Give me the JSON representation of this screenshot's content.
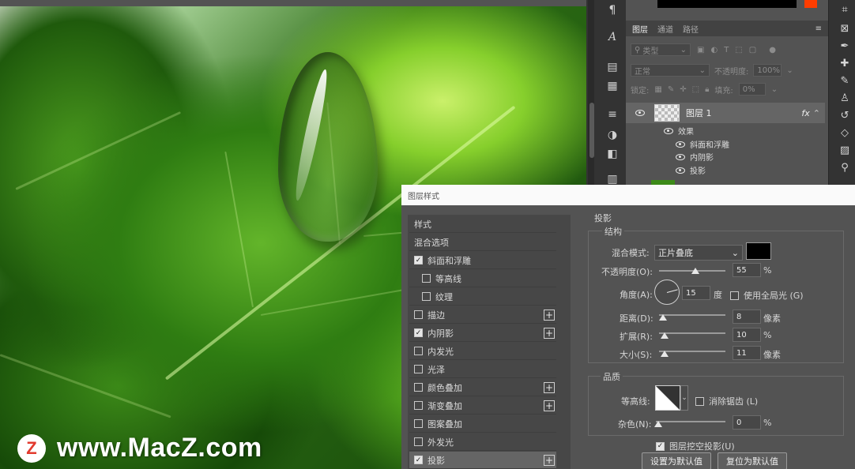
{
  "layers_panel": {
    "tabs": [
      "图层",
      "通道",
      "路径"
    ],
    "kind_filter": "类型",
    "blend_mode": "正常",
    "opacity_label": "不透明度:",
    "opacity_value": "100%",
    "lock_label": "锁定:",
    "fill_label": "填充:",
    "fill_value": "0%",
    "layer_name": "图层 1",
    "fx_badge": "fx",
    "effects_label": "效果",
    "effects": [
      "斜面和浮雕",
      "内阴影",
      "投影"
    ]
  },
  "dialog": {
    "title": "图层样式",
    "styles": [
      {
        "label": "样式",
        "checkbox": false,
        "checked": false,
        "plus": false,
        "indent": false
      },
      {
        "label": "混合选项",
        "checkbox": false,
        "checked": false,
        "plus": false,
        "indent": false
      },
      {
        "label": "斜面和浮雕",
        "checkbox": true,
        "checked": true,
        "plus": false,
        "indent": false
      },
      {
        "label": "等高线",
        "checkbox": true,
        "checked": false,
        "plus": false,
        "indent": true
      },
      {
        "label": "纹理",
        "checkbox": true,
        "checked": false,
        "plus": false,
        "indent": true
      },
      {
        "label": "描边",
        "checkbox": true,
        "checked": false,
        "plus": true,
        "indent": false
      },
      {
        "label": "内阴影",
        "checkbox": true,
        "checked": true,
        "plus": true,
        "indent": false
      },
      {
        "label": "内发光",
        "checkbox": true,
        "checked": false,
        "plus": false,
        "indent": false
      },
      {
        "label": "光泽",
        "checkbox": true,
        "checked": false,
        "plus": false,
        "indent": false
      },
      {
        "label": "颜色叠加",
        "checkbox": true,
        "checked": false,
        "plus": true,
        "indent": false
      },
      {
        "label": "渐变叠加",
        "checkbox": true,
        "checked": false,
        "plus": true,
        "indent": false
      },
      {
        "label": "图案叠加",
        "checkbox": true,
        "checked": false,
        "plus": false,
        "indent": false
      },
      {
        "label": "外发光",
        "checkbox": true,
        "checked": false,
        "plus": false,
        "indent": false
      },
      {
        "label": "投影",
        "checkbox": true,
        "checked": true,
        "plus": true,
        "indent": false,
        "selected": true
      }
    ],
    "section_title": "投影",
    "structure_title": "结构",
    "blend_mode_label": "混合模式:",
    "blend_mode_value": "正片叠底",
    "shadow_color": "#000000",
    "opacity_label": "不透明度(O):",
    "opacity_value": "55",
    "opacity_unit": "%",
    "opacity_level": 0.55,
    "angle_label": "角度(A):",
    "angle_value": "15",
    "angle_unit": "度",
    "global_light_label": "使用全局光 (G)",
    "global_light_checked": false,
    "distance_label": "距离(D):",
    "distance_value": "8",
    "distance_unit": "像素",
    "spread_label": "扩展(R):",
    "spread_value": "10",
    "spread_unit": "%",
    "size_label": "大小(S):",
    "size_value": "11",
    "size_unit": "像素",
    "quality_title": "品质",
    "contour_label": "等高线:",
    "antialias_label": "消除锯齿 (L)",
    "antialias_checked": false,
    "noise_label": "杂色(N):",
    "noise_value": "0",
    "noise_unit": "%",
    "knockout_label": "图层挖空投影(U)",
    "knockout_checked": true,
    "make_default_label": "设置为默认值",
    "reset_default_label": "复位为默认值"
  },
  "watermark": {
    "logo_letter": "Z",
    "text": "www.MacZ.com"
  },
  "colors": {
    "foreground_swatch": "#ff3d00",
    "panel_bg": "#535353"
  }
}
